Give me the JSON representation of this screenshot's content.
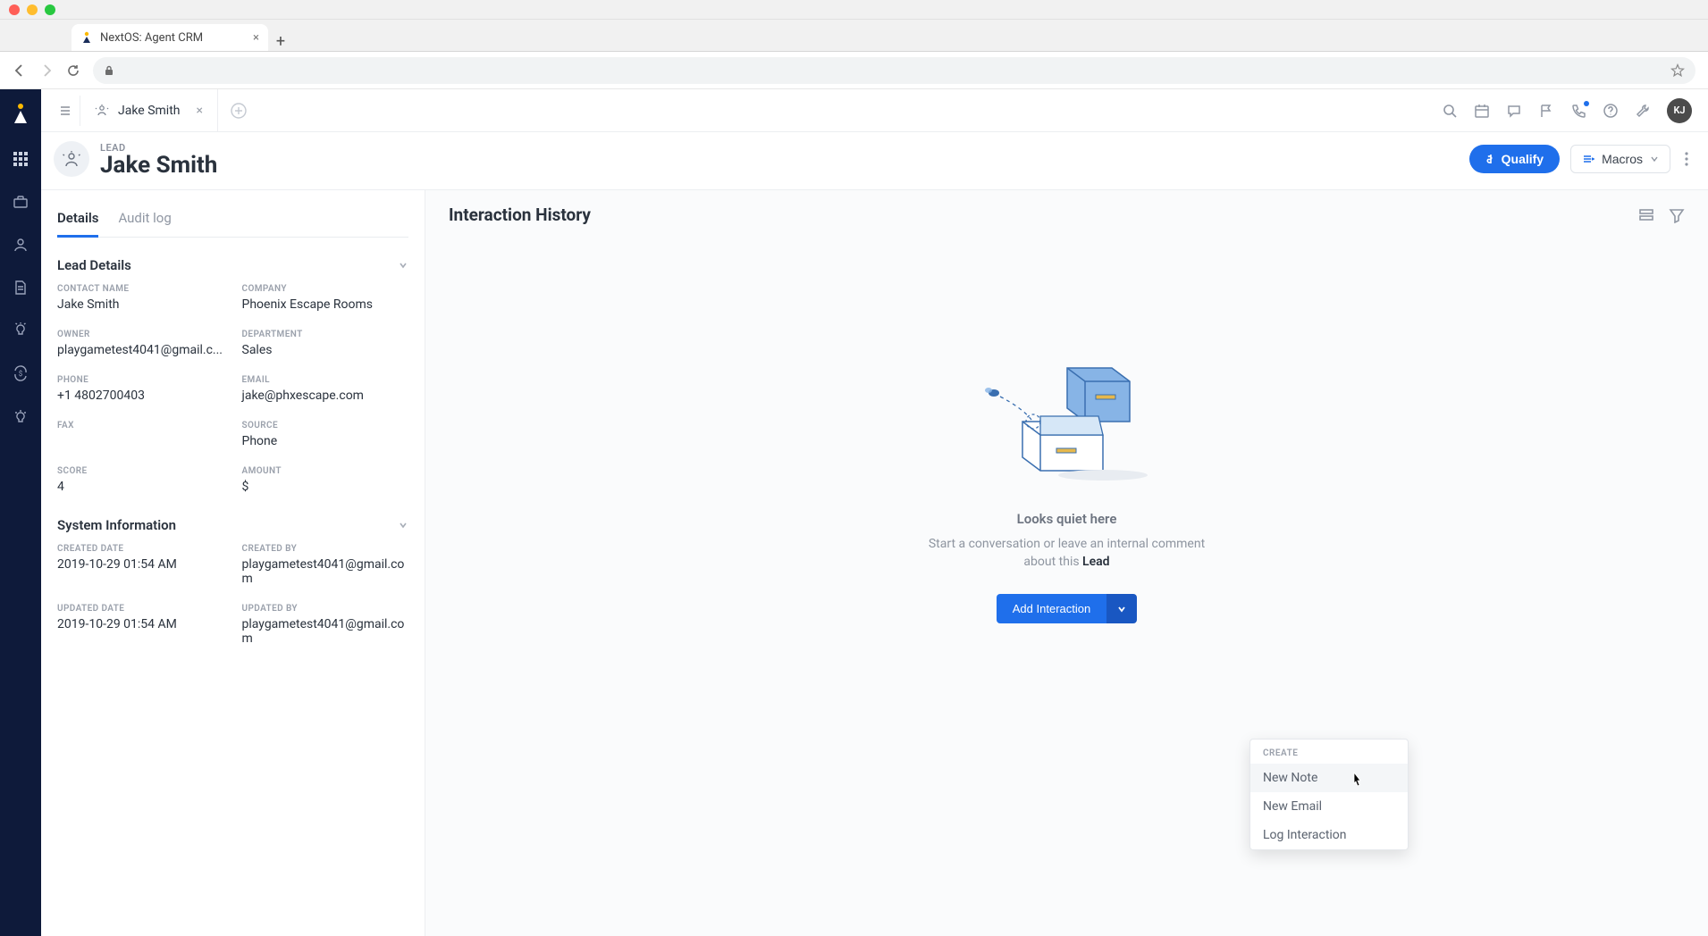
{
  "browser": {
    "tab_title": "NextOS: Agent CRM"
  },
  "tab": {
    "name": "Jake Smith"
  },
  "avatar": "KJ",
  "record": {
    "type_label": "LEAD",
    "name": "Jake Smith"
  },
  "header_actions": {
    "qualify": "Qualify",
    "macros": "Macros"
  },
  "left_tabs": {
    "details": "Details",
    "audit": "Audit log"
  },
  "sections": {
    "lead_details": "Lead Details",
    "system_info": "System Information"
  },
  "fields": {
    "contact_name_lbl": "CONTACT NAME",
    "contact_name": "Jake Smith",
    "company_lbl": "COMPANY",
    "company": "Phoenix Escape Rooms",
    "owner_lbl": "OWNER",
    "owner": "playgametest4041@gmail.c...",
    "department_lbl": "DEPARTMENT",
    "department": "Sales",
    "phone_lbl": "PHONE",
    "phone": "+1 4802700403",
    "email_lbl": "EMAIL",
    "email": "jake@phxescape.com",
    "fax_lbl": "FAX",
    "fax": "",
    "source_lbl": "SOURCE",
    "source": "Phone",
    "score_lbl": "SCORE",
    "score": "4",
    "amount_lbl": "AMOUNT",
    "amount": "$",
    "created_date_lbl": "CREATED DATE",
    "created_date": "2019-10-29 01:54 AM",
    "created_by_lbl": "CREATED BY",
    "created_by": "playgametest4041@gmail.com",
    "updated_date_lbl": "UPDATED DATE",
    "updated_date": "2019-10-29 01:54 AM",
    "updated_by_lbl": "UPDATED BY",
    "updated_by": "playgametest4041@gmail.com"
  },
  "interaction": {
    "title": "Interaction History",
    "empty_title": "Looks quiet here",
    "empty_sub_pre": "Start a conversation or leave an internal comment about this ",
    "empty_sub_bold": "Lead",
    "add_btn": "Add Interaction"
  },
  "dropdown": {
    "header": "CREATE",
    "items": [
      "New Note",
      "New Email",
      "Log Interaction"
    ]
  }
}
